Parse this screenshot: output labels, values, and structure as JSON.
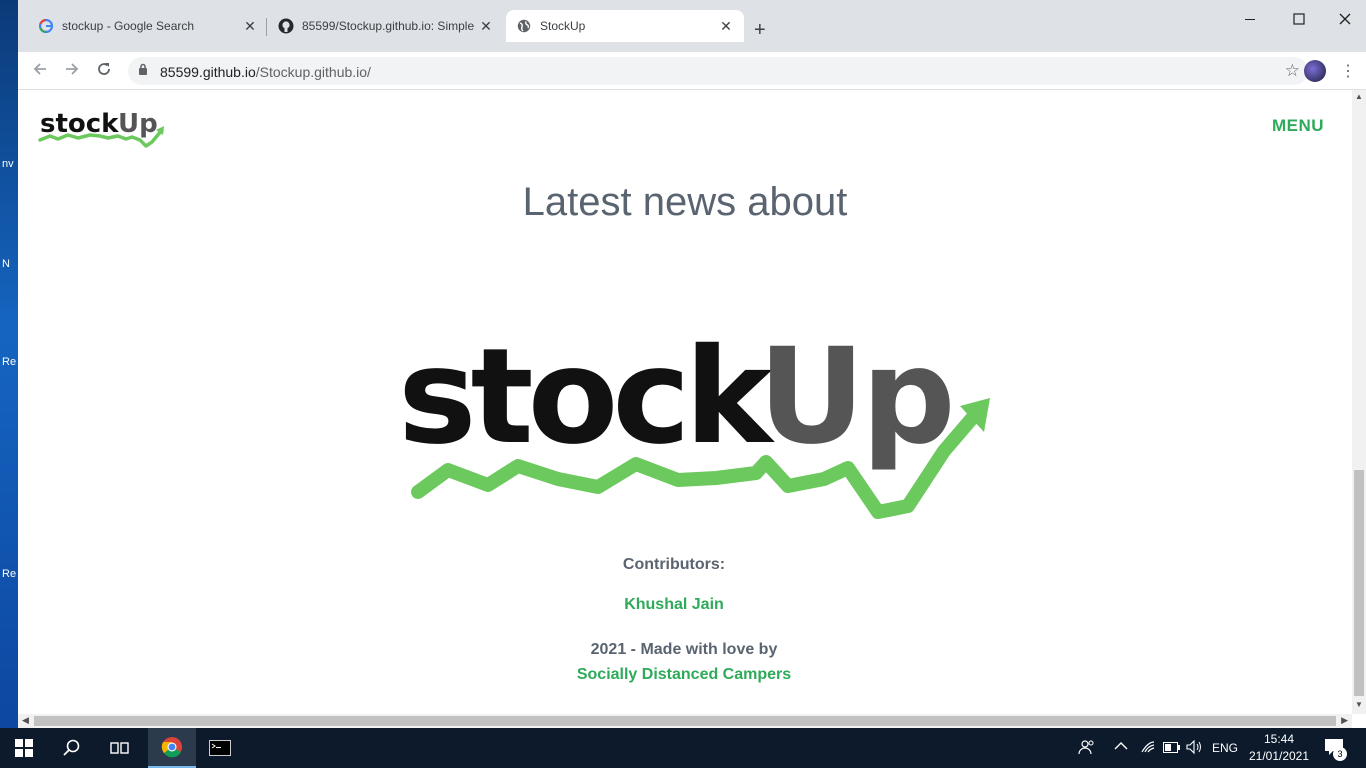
{
  "browser": {
    "tabs": [
      {
        "title": "stockup - Google Search",
        "icon": "google-icon",
        "active": false
      },
      {
        "title": "85599/Stockup.github.io: Simple",
        "icon": "github-icon",
        "active": false
      },
      {
        "title": "StockUp",
        "icon": "globe-icon",
        "active": true
      }
    ],
    "close_glyph": "✕",
    "new_tab_glyph": "+",
    "url_domain": "85599.github.io",
    "url_path": "/Stockup.github.io/"
  },
  "site": {
    "logo_text_dark": "stock",
    "logo_text_light": "Up",
    "menu_label": "MENU",
    "heading": "Latest news about",
    "contributors_label": "Contributors:",
    "contributor_name": "Khushal Jain",
    "footer_line": "2021 - Made with love by",
    "footer_team": "Socially Distanced Campers"
  },
  "colors": {
    "accent_green": "#2eaa5a",
    "logo_green": "#6cc95e",
    "logo_dark": "#111111",
    "logo_grey": "#555555",
    "heading_grey": "#5a6470"
  },
  "taskbar": {
    "language": "ENG",
    "time": "15:44",
    "date": "21/01/2021",
    "notification_count": "3"
  },
  "desktop_labels": [
    "nv",
    "N",
    "Re",
    "Re"
  ]
}
